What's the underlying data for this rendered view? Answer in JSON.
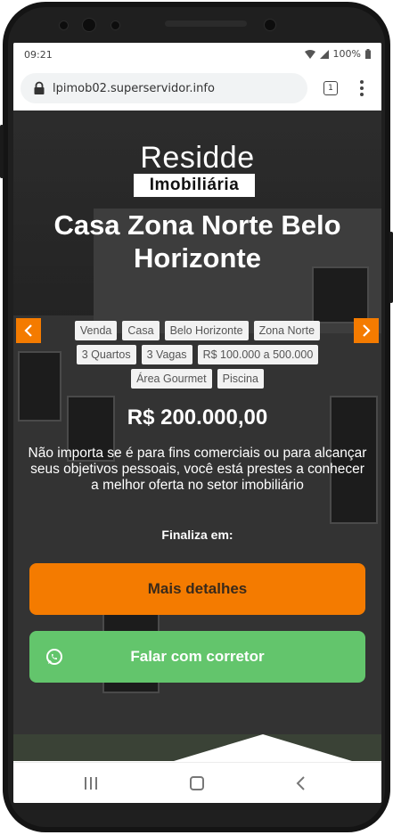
{
  "status_bar": {
    "time": "09:21",
    "battery": "100%"
  },
  "browser": {
    "url": "lpimob02.superservidor.info",
    "tab_count": "1"
  },
  "brand": {
    "name_top": "Residde",
    "name_bottom": "Imobiliária"
  },
  "listing": {
    "title": "Casa Zona Norte Belo Horizonte",
    "tags": [
      "Venda",
      "Casa",
      "Belo Horizonte",
      "Zona Norte",
      "3 Quartos",
      "3 Vagas",
      "R$ 100.000 a 500.000",
      "Área Gourmet",
      "Piscina"
    ],
    "price": "R$ 200.000,00",
    "description": "Não importa se é para fins comerciais ou para alcançar seus objetivos pessoais, você está prestes a conhecer a melhor oferta no setor imobiliário",
    "countdown_label": "Finaliza em:"
  },
  "actions": {
    "details_label": "Mais detalhes",
    "whatsapp_label": "Falar com corretor"
  },
  "colors": {
    "accent_orange": "#f47b00",
    "whatsapp_green": "#63c56c"
  }
}
